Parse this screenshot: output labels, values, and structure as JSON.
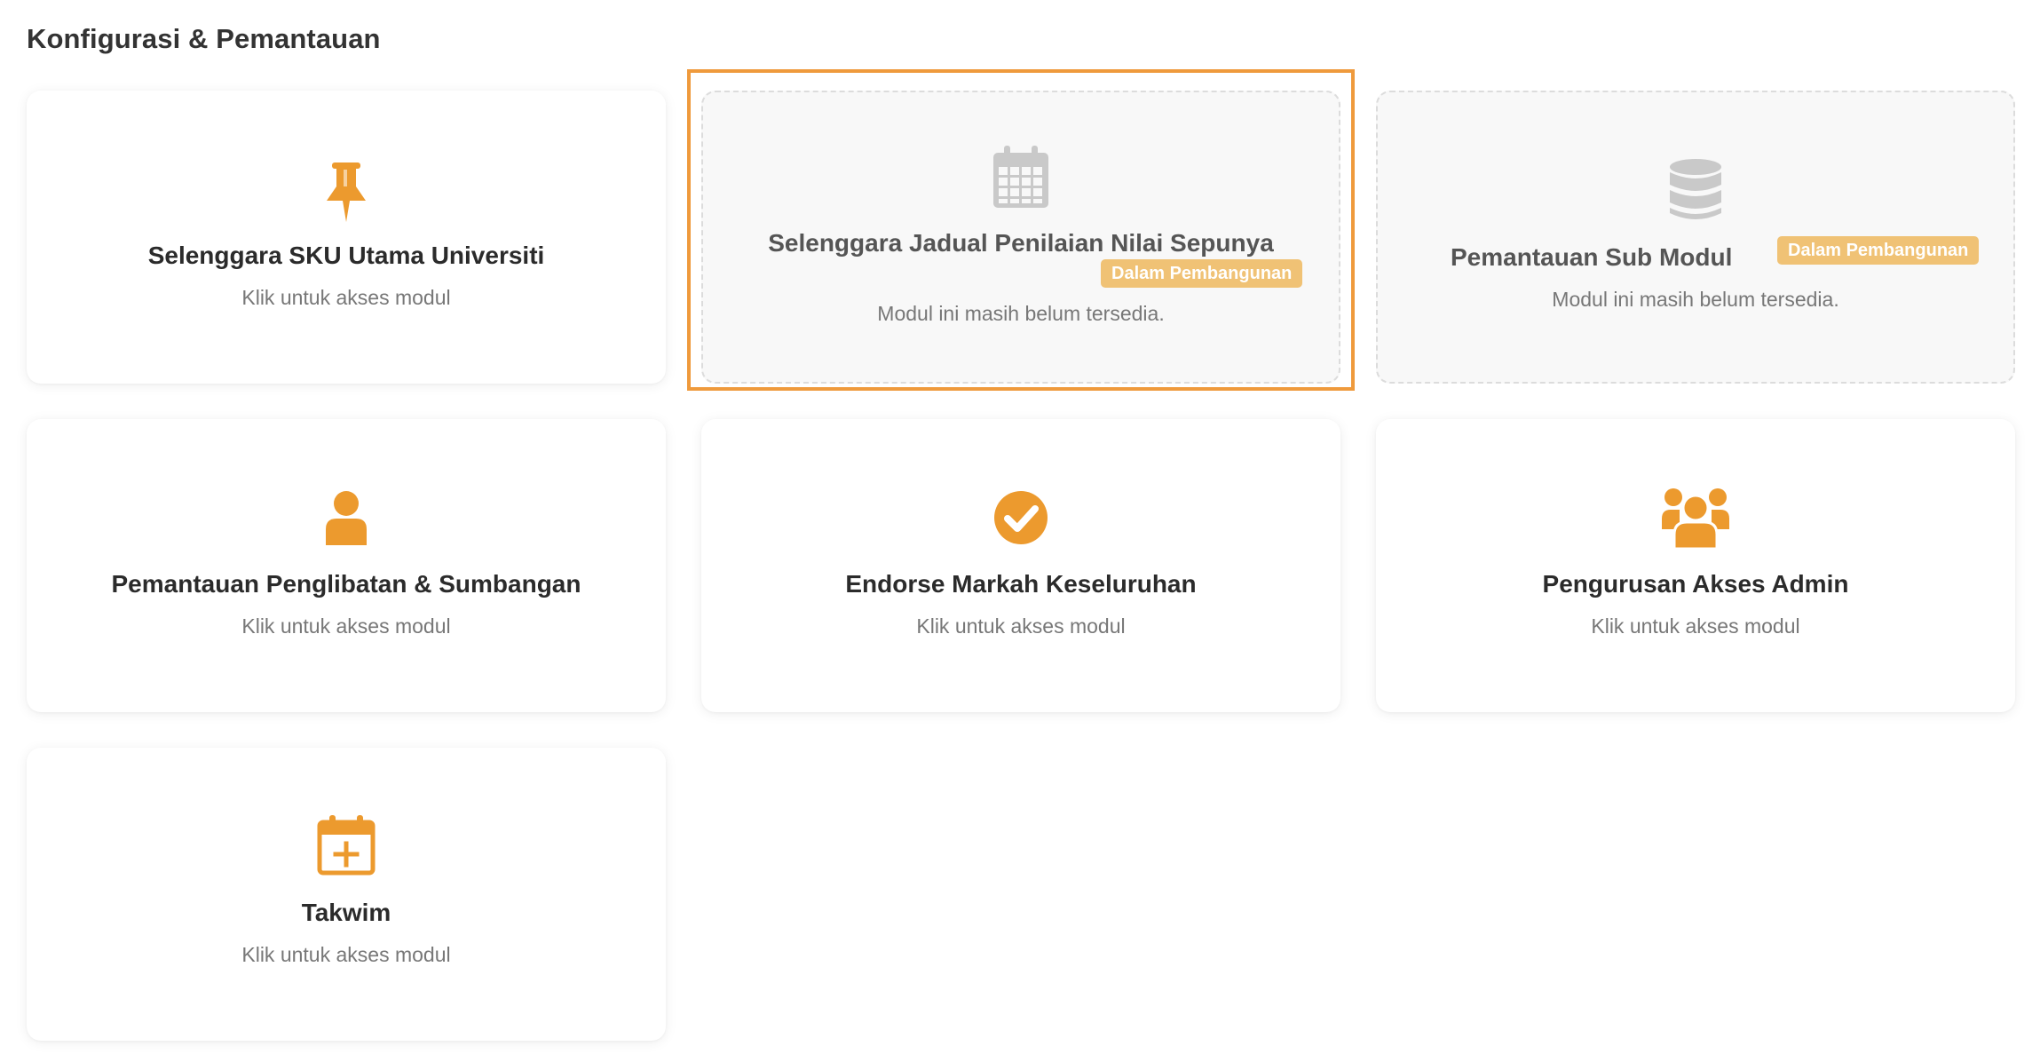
{
  "section": {
    "title": "Konfigurasi & Pemantauan"
  },
  "colors": {
    "accent": "#ec9a2e",
    "disabled_icon": "#c9c9c9",
    "badge": "#f0c275",
    "focus_ring": "#ef9a3c"
  },
  "cards": [
    {
      "icon": "pushpin-icon",
      "title": "Selenggara SKU Utama Universiti",
      "subtitle": "Klik untuk akses modul",
      "status": "available"
    },
    {
      "icon": "calendar-grid-icon",
      "title": "Selenggara Jadual Penilaian Nilai Sepunya",
      "subtitle": "Modul ini masih belum tersedia.",
      "badge": "Dalam Pembangunan",
      "status": "in-development",
      "focused": true
    },
    {
      "icon": "database-icon",
      "title": "Pemantauan Sub Modul",
      "subtitle": "Modul ini masih belum tersedia.",
      "badge": "Dalam Pembangunan",
      "status": "in-development"
    },
    {
      "icon": "user-icon",
      "title": "Pemantauan Penglibatan & Sumbangan",
      "subtitle": "Klik untuk akses modul",
      "status": "available"
    },
    {
      "icon": "check-circle-icon",
      "title": "Endorse Markah Keseluruhan",
      "subtitle": "Klik untuk akses modul",
      "status": "available"
    },
    {
      "icon": "users-group-icon",
      "title": "Pengurusan Akses Admin",
      "subtitle": "Klik untuk akses modul",
      "status": "available"
    },
    {
      "icon": "calendar-plus-icon",
      "title": "Takwim",
      "subtitle": "Klik untuk akses modul",
      "status": "available"
    }
  ]
}
